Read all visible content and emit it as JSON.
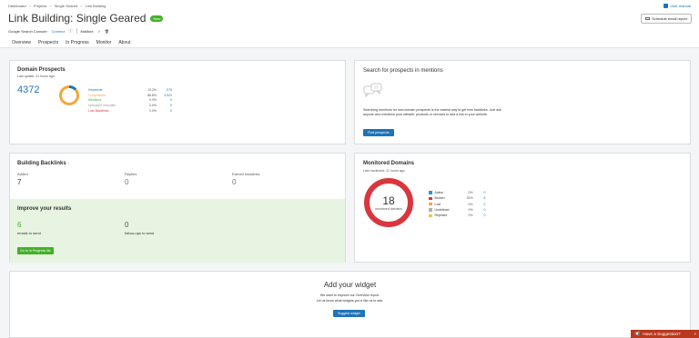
{
  "breadcrumb": [
    "Dashboard",
    "Projects",
    "Single Geared",
    "Link Building"
  ],
  "header": {
    "title": "Link Building: Single Geared",
    "badge": "New",
    "gsc_label": "Google Search Console:",
    "gsc_link": "Connect",
    "mailbox_label": "Mailbox:",
    "user_manual": "User manual",
    "schedule_btn": "Schedule email report"
  },
  "tabs": [
    "Overview",
    "Prospects",
    "In Progress",
    "Monitor",
    "About"
  ],
  "domain_prospects": {
    "title": "Domain Prospects",
    "updated": "Last update: 21 hours ago",
    "total": "4372",
    "rows": [
      {
        "label": "Keywords",
        "pct": "13.2%",
        "count": "576",
        "color": "#1f73b7"
      },
      {
        "label": "Competitors",
        "pct": "86.8%",
        "count": "3,924",
        "color": "#f3a73b"
      },
      {
        "label": "Mentions",
        "pct": "0.0%",
        "count": "0",
        "color": "#43b02a"
      },
      {
        "label": "Uploaded manually",
        "pct": "0.0%",
        "count": "0",
        "color": "#999999"
      },
      {
        "label": "Lost Backlinks",
        "pct": "0.0%",
        "count": "0",
        "color": "#d9363e"
      }
    ],
    "fractions": [
      0.132,
      0.868
    ]
  },
  "mentions": {
    "title": "Search for prospects in mentions",
    "desc": "Searching mentions for new domain prospects is the easiest way to get new backlinks. Just ask anyone who mentions your website, products or services to add a link to your website.",
    "button": "Find prospects"
  },
  "building": {
    "title": "Building Backlinks",
    "info": "i",
    "cols": [
      {
        "label": "Added",
        "value": "7"
      },
      {
        "label": "Replies",
        "value": "0"
      },
      {
        "label": "Earned backlinks",
        "value": "0"
      }
    ],
    "improve_title": "Improve your results",
    "improve": [
      {
        "value": "6",
        "label": "emails to send"
      },
      {
        "value": "0",
        "label": "follow-ups to send"
      }
    ],
    "button": "Go to In Progress list"
  },
  "monitored": {
    "title": "Monitored Domains",
    "updated": "Last monitored: 21 hours ago",
    "total": "18",
    "center_label": "monitored domains",
    "rows": [
      {
        "label": "Active",
        "pct": "0%",
        "count": "0",
        "color": "#1f9bd7"
      },
      {
        "label": "Broken",
        "pct": "33%",
        "count": "6",
        "color": "#d9363e"
      },
      {
        "label": "Lost",
        "pct": "0%",
        "count": "0",
        "color": "#f3a73b"
      },
      {
        "label": "Undefined",
        "pct": "0%",
        "count": "0",
        "color": "#b0b0b0"
      },
      {
        "label": "Rejected",
        "pct": "0%",
        "count": "0",
        "color": "#f3c13b"
      }
    ],
    "ring_color": "#d9363e"
  },
  "widget": {
    "title": "Add your widget",
    "line1": "We want to improve our Overview report.",
    "line2": "Let us know what widgets you'd like us to add.",
    "button": "Suggest widget"
  },
  "suggestion": {
    "label": "Have a Suggestion?",
    "close": "×"
  }
}
